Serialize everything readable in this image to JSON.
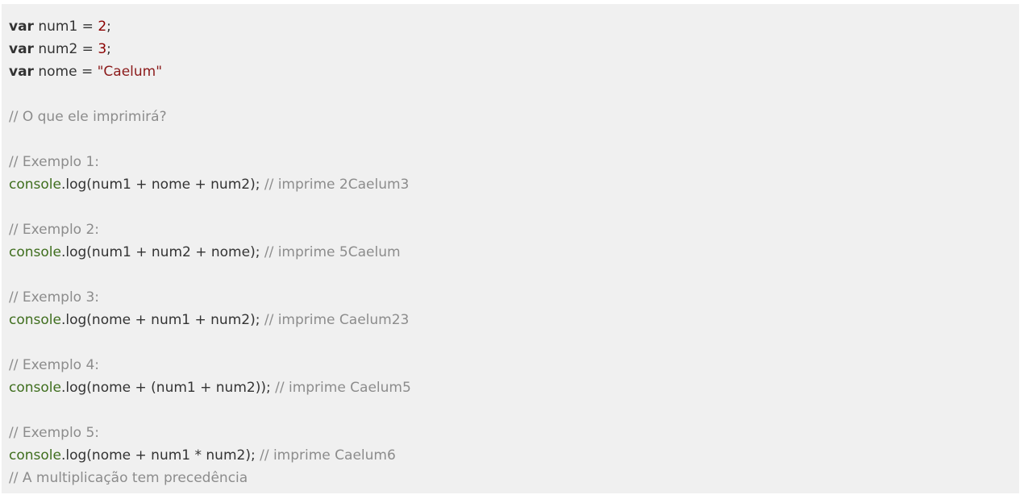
{
  "code": {
    "line1": {
      "kw": "var",
      "rest": " num1 = ",
      "num": "2",
      "end": ";"
    },
    "line2": {
      "kw": "var",
      "rest": " num2 = ",
      "num": "3",
      "end": ";"
    },
    "line3": {
      "kw": "var",
      "rest": " nome = ",
      "str": "\"Caelum\""
    },
    "comment_question": "// O que ele imprimirá?",
    "ex1": {
      "label": "// Exemplo 1:",
      "obj": "console",
      "call": ".log(num1 + nome + num2); ",
      "comment": "// imprime 2Caelum3"
    },
    "ex2": {
      "label": "// Exemplo 2:",
      "obj": "console",
      "call": ".log(num1 + num2 + nome); ",
      "comment": "// imprime 5Caelum"
    },
    "ex3": {
      "label": "// Exemplo 3:",
      "obj": "console",
      "call": ".log(nome + num1 + num2); ",
      "comment": "// imprime Caelum23"
    },
    "ex4": {
      "label": "// Exemplo 4:",
      "obj": "console",
      "call": ".log(nome + (num1 + num2)); ",
      "comment": "// imprime Caelum5"
    },
    "ex5": {
      "label": "// Exemplo 5:",
      "obj": "console",
      "call": ".log(nome + num1 * num2); ",
      "comment": "// imprime Caelum6",
      "note": "// A multiplicação tem precedência"
    }
  }
}
